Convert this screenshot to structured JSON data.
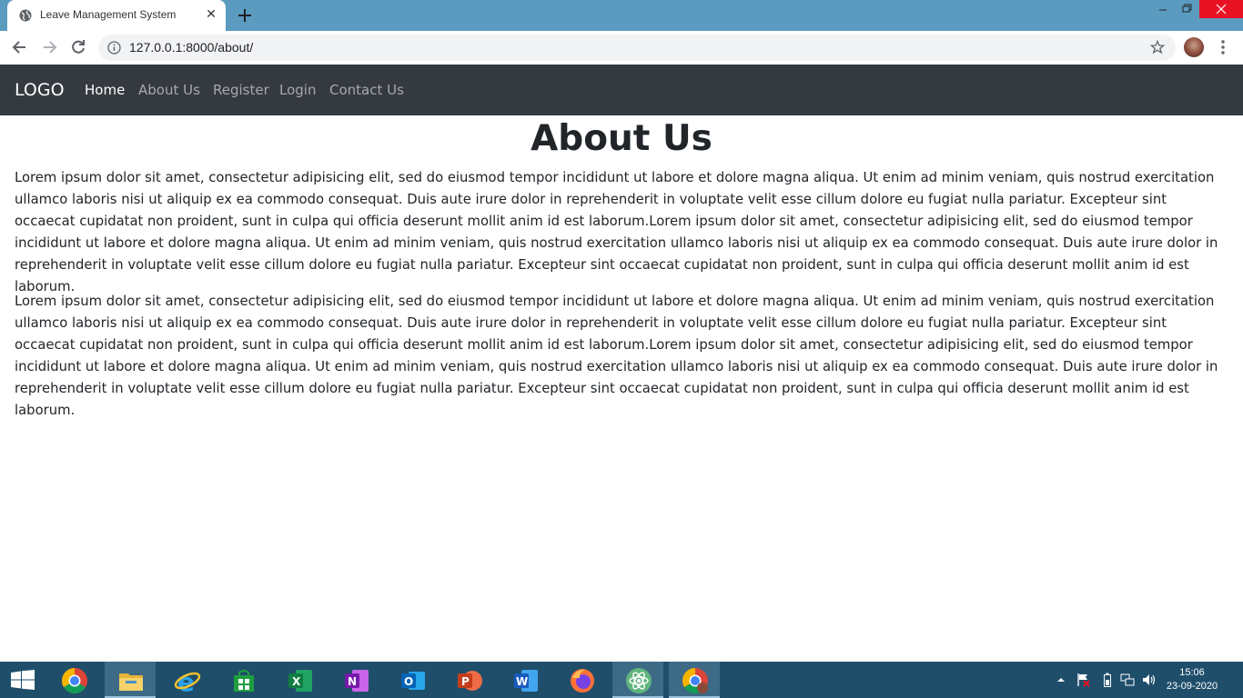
{
  "browser": {
    "tab_title": "Leave Management System",
    "url": "127.0.0.1:8000/about/"
  },
  "site": {
    "brand": "LOGO",
    "nav": [
      "Home",
      "About Us",
      "Register",
      "Login",
      "Contact Us"
    ],
    "active_nav": "Home"
  },
  "page": {
    "title": "About Us",
    "paragraphs": [
      "Lorem ipsum dolor sit amet, consectetur adipisicing elit, sed do eiusmod tempor incididunt ut labore et dolore magna aliqua. Ut enim ad minim veniam, quis nostrud exercitation ullamco laboris nisi ut aliquip ex ea commodo consequat. Duis aute irure dolor in reprehenderit in voluptate velit esse cillum dolore eu fugiat nulla pariatur. Excepteur sint occaecat cupidatat non proident, sunt in culpa qui officia deserunt mollit anim id est laborum.Lorem ipsum dolor sit amet, consectetur adipisicing elit, sed do eiusmod tempor incididunt ut labore et dolore magna aliqua. Ut enim ad minim veniam, quis nostrud exercitation ullamco laboris nisi ut aliquip ex ea commodo consequat. Duis aute irure dolor in reprehenderit in voluptate velit esse cillum dolore eu fugiat nulla pariatur. Excepteur sint occaecat cupidatat non proident, sunt in culpa qui officia deserunt mollit anim id est laborum.",
      "Lorem ipsum dolor sit amet, consectetur adipisicing elit, sed do eiusmod tempor incididunt ut labore et dolore magna aliqua. Ut enim ad minim veniam, quis nostrud exercitation ullamco laboris nisi ut aliquip ex ea commodo consequat. Duis aute irure dolor in reprehenderit in voluptate velit esse cillum dolore eu fugiat nulla pariatur. Excepteur sint occaecat cupidatat non proident, sunt in culpa qui officia deserunt mollit anim id est laborum.Lorem ipsum dolor sit amet, consectetur adipisicing elit, sed do eiusmod tempor incididunt ut labore et dolore magna aliqua. Ut enim ad minim veniam, quis nostrud exercitation ullamco laboris nisi ut aliquip ex ea commodo consequat. Duis aute irure dolor in reprehenderit in voluptate velit esse cillum dolore eu fugiat nulla pariatur. Excepteur sint occaecat cupidatat non proident, sunt in culpa qui officia deserunt mollit anim id est laborum."
    ]
  },
  "taskbar": {
    "apps": [
      "start-icon",
      "chrome-icon",
      "file-explorer-icon",
      "internet-explorer-icon",
      "microsoft-store-icon",
      "excel-icon",
      "onenote-icon",
      "outlook-icon",
      "powerpoint-icon",
      "word-icon",
      "firefox-icon",
      "atom-icon",
      "chrome-active-icon"
    ],
    "time": "15:06",
    "date": "23-09-2020"
  },
  "colors": {
    "navbar_bg": "#343a40",
    "tabstrip_bg": "#5b9bc0",
    "taskbar_bg": "#1f4e6b",
    "text": "#212529"
  }
}
